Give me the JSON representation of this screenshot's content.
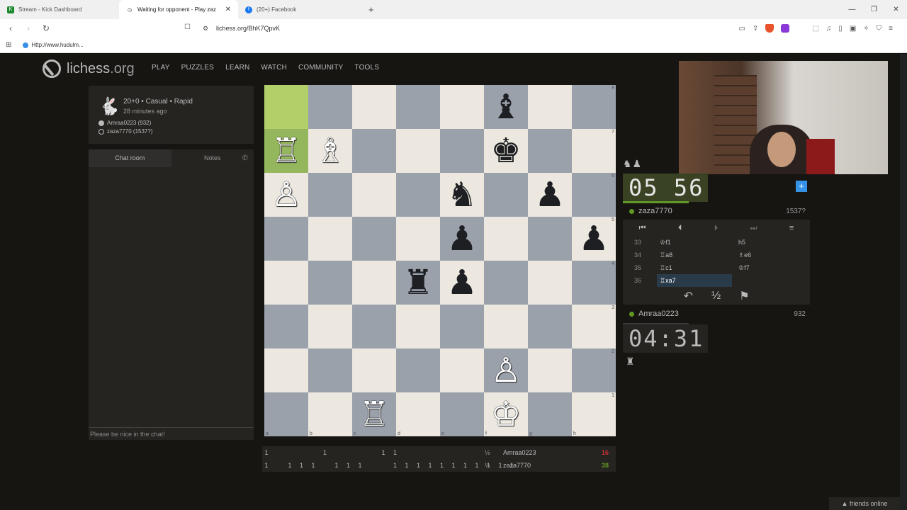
{
  "browser": {
    "tabs": [
      {
        "title": "Stream - Kick Dashboard",
        "favicon_color": "#1c8a2d",
        "favicon_glyph": "K"
      },
      {
        "title": "Waiting for opponent - Play zaz",
        "favicon_color": "#555555",
        "favicon_glyph": "◷"
      },
      {
        "title": "(20+) Facebook",
        "favicon_color": "#1877f2",
        "favicon_glyph": "f"
      }
    ],
    "new_tab": "+",
    "url": "lichess.org/BhK7QpvK",
    "bookmark": "Http://www.hudulm..."
  },
  "site": {
    "logo_main": "lichess",
    "logo_tld": ".org",
    "nav": [
      "PLAY",
      "PUZZLES",
      "LEARN",
      "WATCH",
      "COMMUNITY",
      "TOOLS"
    ]
  },
  "game_meta": {
    "title": "20+0 • Casual • Rapid",
    "time_ago": "28 minutes ago",
    "white_player": "Amraa0223 (932)",
    "black_player": "zaza7770 (1537?)"
  },
  "chat": {
    "tab_chat": "Chat room",
    "tab_notes": "Notes",
    "placeholder": "Please be nice in the chat!"
  },
  "board": {
    "ranks": [
      "8",
      "7",
      "6",
      "5",
      "4",
      "3",
      "2",
      "1"
    ],
    "files": [
      "a",
      "b",
      "c",
      "d",
      "e",
      "f",
      "g",
      "h"
    ],
    "position": [
      [
        "",
        "",
        "",
        "",
        "",
        "bB",
        "",
        ""
      ],
      [
        "wR",
        "wB",
        "",
        "",
        "",
        "bK",
        "",
        ""
      ],
      [
        "wP",
        "",
        "",
        "",
        "bN",
        "",
        "bP",
        ""
      ],
      [
        "",
        "",
        "",
        "",
        "bP",
        "",
        "",
        "bP"
      ],
      [
        "",
        "",
        "",
        "bR",
        "bP",
        "",
        "",
        ""
      ],
      [
        "",
        "",
        "",
        "",
        "",
        "",
        "",
        ""
      ],
      [
        "",
        "",
        "",
        "",
        "",
        "wP",
        "",
        ""
      ],
      [
        "",
        "",
        "wR",
        "",
        "",
        "wK",
        "",
        ""
      ]
    ],
    "highlighted": [
      "a8",
      "a7"
    ]
  },
  "opponent": {
    "name": "zaza7770",
    "rating": "1537?",
    "clock": "05 56",
    "material": "♞♟"
  },
  "me": {
    "name": "Amraa0223",
    "rating": "932",
    "clock": "04:31",
    "material": "♜"
  },
  "moves": [
    {
      "num": "33",
      "white": "♔f1",
      "black": "h5"
    },
    {
      "num": "34",
      "white": "♖a8",
      "black": "♗e6"
    },
    {
      "num": "35",
      "white": "♖c1",
      "black": "♔f7"
    },
    {
      "num": "36",
      "white": "♖xa7",
      "black": ""
    }
  ],
  "move_nav": [
    "⏮",
    "⏴",
    "⏵",
    "⏭",
    "≡"
  ],
  "controls": [
    "↶",
    "½",
    "⚑"
  ],
  "crosstable": {
    "players": [
      {
        "name": "Amraa0223",
        "score": "16",
        "score_color": "#cc3333",
        "half": "½",
        "cells": [
          "1",
          "",
          "",
          "",
          "",
          "1",
          "",
          "",
          "",
          "",
          "1",
          "1",
          "",
          "",
          "",
          "",
          "",
          "",
          "",
          "",
          "",
          "",
          ""
        ]
      },
      {
        "name": "zaza7770",
        "score": "38",
        "score_color": "#629924",
        "half": "½",
        "cells": [
          "1",
          "",
          "1",
          "1",
          "1",
          "",
          "1",
          "1",
          "1",
          "",
          "",
          "1",
          "1",
          "1",
          "1",
          "1",
          "1",
          "1",
          "1",
          "1",
          "1",
          "1",
          ""
        ]
      }
    ]
  },
  "friends": "friends online"
}
